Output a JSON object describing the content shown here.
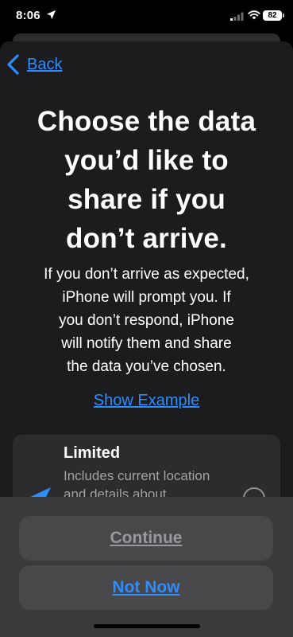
{
  "status_bar": {
    "time": "8:06",
    "battery": "82",
    "icons": [
      "location-arrow-icon",
      "cellular-signal-icon",
      "wifi-icon",
      "battery-icon"
    ]
  },
  "nav": {
    "back_label": "Back",
    "back_icon": "chevron-left-icon"
  },
  "headline": {
    "line1": "Choose the data",
    "line2": "you’d like to",
    "line3": "share if you",
    "line4": "don’t arrive."
  },
  "body": {
    "line1": "If you don’t arrive as expected,",
    "line2": "iPhone will prompt you. If",
    "line3": "you don’t respond, iPhone",
    "line4": "will notify them and share",
    "line5": "the data you’ve chosen."
  },
  "example_link": "Show Example",
  "option": {
    "title": "Limited",
    "desc_line1": "Includes current location",
    "desc_line2": "and details about",
    "icon": "location-arrow-icon",
    "selected": false
  },
  "buttons": {
    "continue": "Continue",
    "not_now": "Not Now"
  },
  "colors": {
    "accent": "#2d8dff",
    "sheet": "#1c1c1e",
    "card": "#2c2c2e",
    "button": "#48484a"
  }
}
